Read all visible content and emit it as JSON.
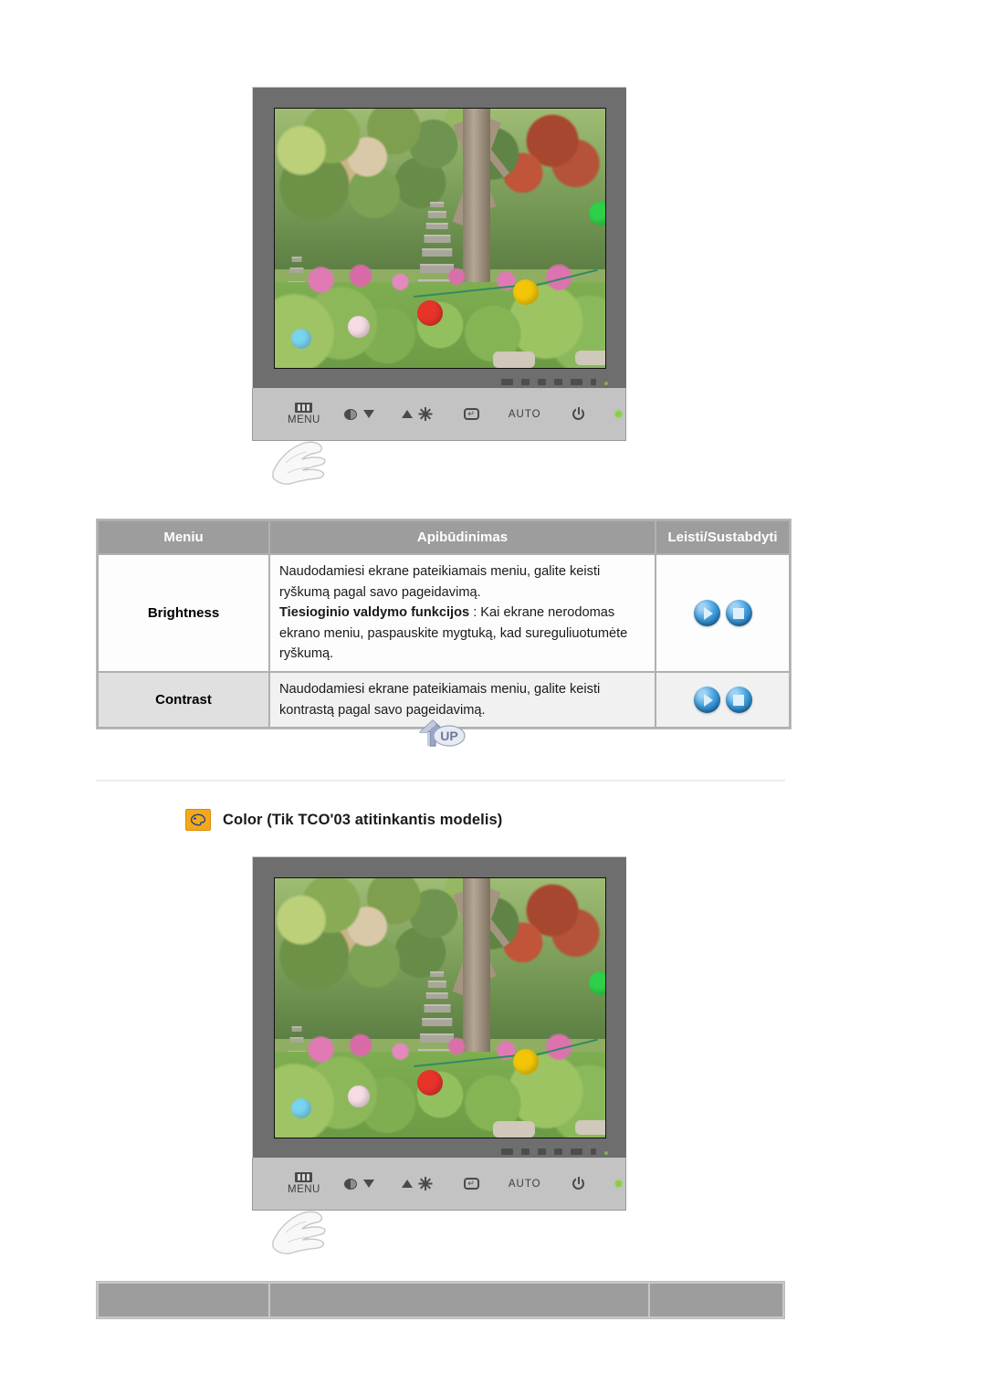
{
  "table": {
    "headers": [
      "Meniu",
      "Apibūdinimas",
      "Leisti/Sustabdyti"
    ],
    "rows": [
      {
        "menu": "Brightness",
        "desc_line1": "Naudodamiesi ekrane pateikiamais meniu, galite keisti ryškumą pagal savo pageidavimą.",
        "desc_bold": "Tiesioginio valdymo funkcijos",
        "desc_line2": " : Kai ekrane nerodomas ekrano meniu, paspauskite mygtuką, kad sureguliuotumėte ryškumą.",
        "actions": [
          "play-icon",
          "stop-icon"
        ]
      },
      {
        "menu": "Contrast",
        "desc_line1": "Naudodamiesi ekrane pateikiamais meniu, galite keisti kontrastą pagal savo pageidavimą.",
        "desc_bold": "",
        "desc_line2": "",
        "actions": [
          "play-icon",
          "stop-icon"
        ]
      }
    ]
  },
  "up_button": {
    "label": "UP"
  },
  "section": {
    "icon": "color-palette-icon",
    "title": "Color (Tik TCO'03 atitinkantis modelis)"
  },
  "monitor_controls": {
    "menu_label": "MENU",
    "auto_label": "AUTO",
    "buttons": [
      "menu-button",
      "contrast-down-button",
      "brightness-up-button",
      "enter-source-button",
      "auto-button",
      "power-button",
      "power-led"
    ]
  },
  "colors": {
    "header_bg": "#9d9d9d",
    "menu_cell_bg": "#e0e0e0",
    "alt_row_bg": "#f1f1f1",
    "accent_orange": "#f5a81c",
    "orb_blue": "#3f9ddb",
    "led_green": "#86d13c"
  }
}
